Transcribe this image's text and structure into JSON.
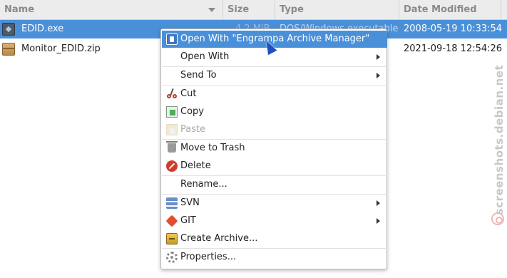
{
  "columns": {
    "name": "Name",
    "size": "Size",
    "type": "Type",
    "date_modified": "Date Modified"
  },
  "files": [
    {
      "name": "EDID.exe",
      "size": "4.2 MiB",
      "type": "DOS/Windows executable",
      "date": "2008-05-19 10:33:54",
      "icon": "exe-icon",
      "selected": true
    },
    {
      "name": "Monitor_EDID.zip",
      "size": "",
      "type": "",
      "date": "2021-09-18 12:54:26",
      "icon": "zip-icon",
      "selected": false
    }
  ],
  "context_menu": {
    "open_with_app": "Open With \"Engrampa Archive Manager\"",
    "open_with": "Open With",
    "send_to": "Send To",
    "cut": "Cut",
    "copy": "Copy",
    "paste": "Paste",
    "move_to_trash": "Move to Trash",
    "delete": "Delete",
    "rename": "Rename...",
    "svn": "SVN",
    "git": "GIT",
    "create_archive": "Create Archive...",
    "properties": "Properties..."
  },
  "watermark": "screenshots.debian.net",
  "colors": {
    "selection": "#4a90d9",
    "header_bg": "#ececec"
  }
}
